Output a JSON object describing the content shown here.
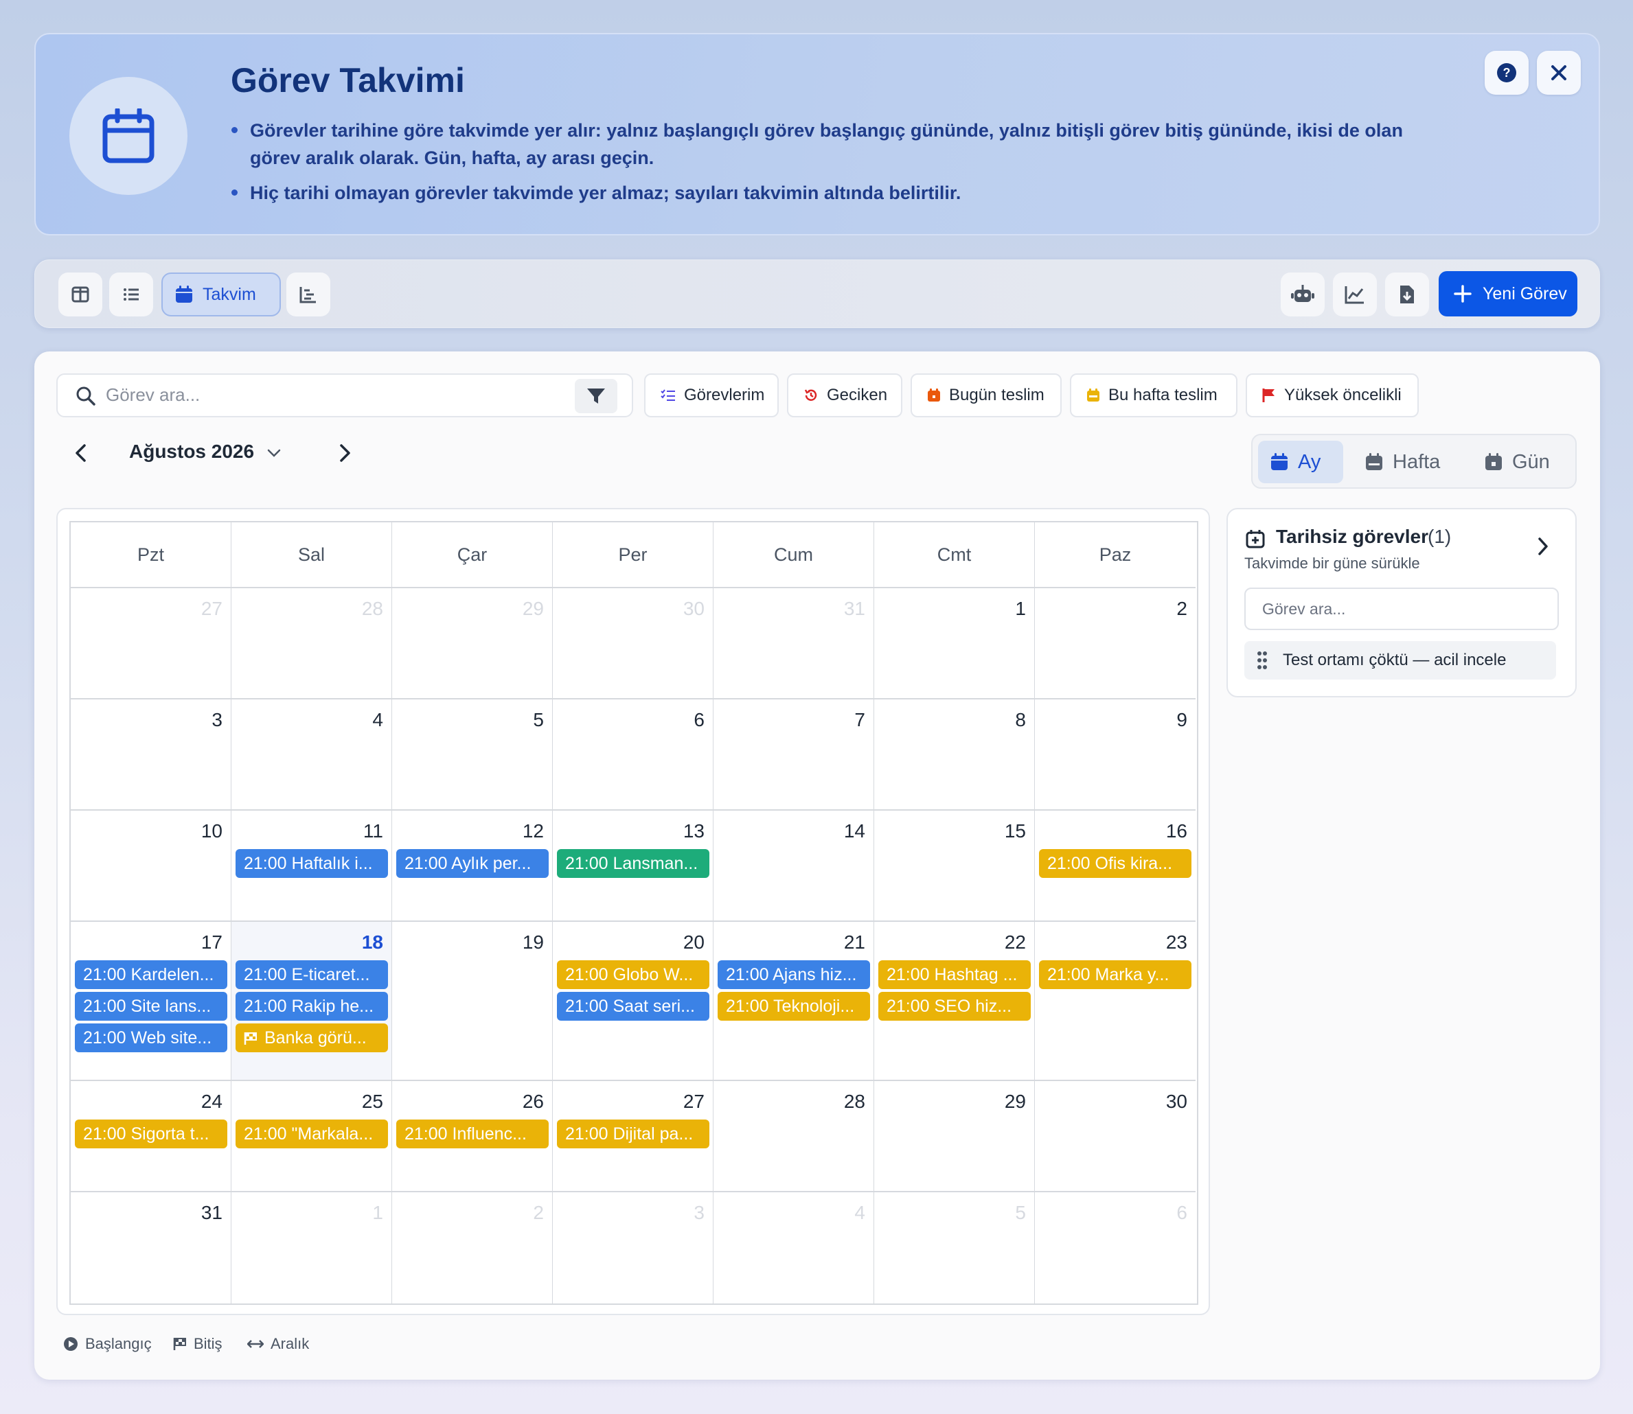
{
  "header": {
    "title": "Görev Takvimi",
    "bullets": [
      "Görevler tarihine göre takvimde yer alır: yalnız başlangıçlı görev başlangıç gününde, yalnız bitişli görev bitiş gününde, ikisi de olan görev aralık olarak. Gün, hafta, ay arası geçin.",
      "Hiç tarihi olmayan görevler takvimde yer almaz; sayıları takvimin altında belirtilir."
    ],
    "icons": [
      "calendar-icon",
      "help-icon",
      "close-icon"
    ]
  },
  "toolbar": {
    "views": [
      "board-view",
      "list-view",
      "calendar-view",
      "gantt-view"
    ],
    "active_tab_label": "Takvim",
    "right_icons": [
      "robot-icon",
      "chart-icon",
      "download-icon"
    ],
    "new_task_label": "Yeni Görev"
  },
  "search": {
    "placeholder": "Görev ara..."
  },
  "filters": [
    {
      "label": "Görevlerim",
      "icon": "list-check-icon",
      "color": "#4f46e5"
    },
    {
      "label": "Geciken",
      "icon": "history-icon",
      "color": "#dc2626"
    },
    {
      "label": "Bugün teslim",
      "icon": "calendar-day-icon",
      "color": "#ea580c"
    },
    {
      "label": "Bu hafta teslim",
      "icon": "calendar-week-icon",
      "color": "#eab308"
    },
    {
      "label": "Yüksek öncelikli",
      "icon": "flag-icon",
      "color": "#dc2626"
    }
  ],
  "calendar": {
    "month_label": "Ağustos 2026",
    "view_modes": [
      "Ay",
      "Hafta",
      "Gün"
    ],
    "active_view": "Ay",
    "weekdays": [
      "Pzt",
      "Sal",
      "Çar",
      "Per",
      "Cum",
      "Cmt",
      "Paz"
    ],
    "weeks": [
      [
        {
          "d": "27",
          "m": true
        },
        {
          "d": "28",
          "m": true
        },
        {
          "d": "29",
          "m": true
        },
        {
          "d": "30",
          "m": true
        },
        {
          "d": "31",
          "m": true
        },
        {
          "d": "1"
        },
        {
          "d": "2"
        }
      ],
      [
        {
          "d": "3"
        },
        {
          "d": "4"
        },
        {
          "d": "5"
        },
        {
          "d": "6"
        },
        {
          "d": "7"
        },
        {
          "d": "8"
        },
        {
          "d": "9"
        }
      ],
      [
        {
          "d": "10"
        },
        {
          "d": "11",
          "events": [
            {
              "t": "21:00 Haftalık i...",
              "c": "blue"
            }
          ]
        },
        {
          "d": "12",
          "events": [
            {
              "t": "21:00 Aylık per...",
              "c": "blue"
            }
          ]
        },
        {
          "d": "13",
          "events": [
            {
              "t": "21:00 Lansman...",
              "c": "green"
            }
          ]
        },
        {
          "d": "14"
        },
        {
          "d": "15"
        },
        {
          "d": "16",
          "events": [
            {
              "t": "21:00 Ofis kira...",
              "c": "yellow"
            }
          ]
        }
      ],
      [
        {
          "d": "17",
          "events": [
            {
              "t": "21:00 Kardelen...",
              "c": "blue"
            },
            {
              "t": "21:00 Site lans...",
              "c": "blue"
            },
            {
              "t": "21:00 Web site...",
              "c": "blue"
            }
          ]
        },
        {
          "d": "18",
          "today": true,
          "events": [
            {
              "t": "21:00 E-ticaret...",
              "c": "blue"
            },
            {
              "t": "21:00 Rakip he...",
              "c": "blue"
            },
            {
              "t": "Banka görü...",
              "c": "yellow",
              "flag": true
            }
          ]
        },
        {
          "d": "19"
        },
        {
          "d": "20",
          "events": [
            {
              "t": "21:00 Globo W...",
              "c": "yellow"
            },
            {
              "t": "21:00 Saat seri...",
              "c": "blue"
            }
          ]
        },
        {
          "d": "21",
          "events": [
            {
              "t": "21:00 Ajans hiz...",
              "c": "blue"
            },
            {
              "t": "21:00 Teknoloji...",
              "c": "yellow"
            }
          ]
        },
        {
          "d": "22",
          "events": [
            {
              "t": "21:00 Hashtag ...",
              "c": "yellow"
            },
            {
              "t": "21:00 SEO hiz...",
              "c": "yellow"
            }
          ]
        },
        {
          "d": "23",
          "events": [
            {
              "t": "21:00 Marka y...",
              "c": "yellow"
            }
          ]
        }
      ],
      [
        {
          "d": "24",
          "events": [
            {
              "t": "21:00 Sigorta t...",
              "c": "yellow"
            }
          ]
        },
        {
          "d": "25",
          "events": [
            {
              "t": "21:00 \"Markala...",
              "c": "yellow"
            }
          ]
        },
        {
          "d": "26",
          "events": [
            {
              "t": "21:00 Influenc...",
              "c": "yellow"
            }
          ]
        },
        {
          "d": "27",
          "events": [
            {
              "t": "21:00 Dijital pa...",
              "c": "yellow"
            }
          ]
        },
        {
          "d": "28"
        },
        {
          "d": "29"
        },
        {
          "d": "30"
        }
      ],
      [
        {
          "d": "31"
        },
        {
          "d": "1",
          "m": true
        },
        {
          "d": "2",
          "m": true
        },
        {
          "d": "3",
          "m": true
        },
        {
          "d": "4",
          "m": true
        },
        {
          "d": "5",
          "m": true
        },
        {
          "d": "6",
          "m": true
        }
      ]
    ]
  },
  "undated": {
    "title": "Tarihsiz görevler",
    "count": "(1)",
    "subtitle": "Takvimde bir güne sürükle",
    "search_placeholder": "Görev ara...",
    "items": [
      "Test ortamı çöktü — acil incele"
    ]
  },
  "legend": [
    {
      "label": "Başlangıç",
      "icon": "play-circle-icon"
    },
    {
      "label": "Bitiş",
      "icon": "flag-checkered-icon"
    },
    {
      "label": "Aralık",
      "icon": "arrows-horizontal-icon"
    }
  ]
}
